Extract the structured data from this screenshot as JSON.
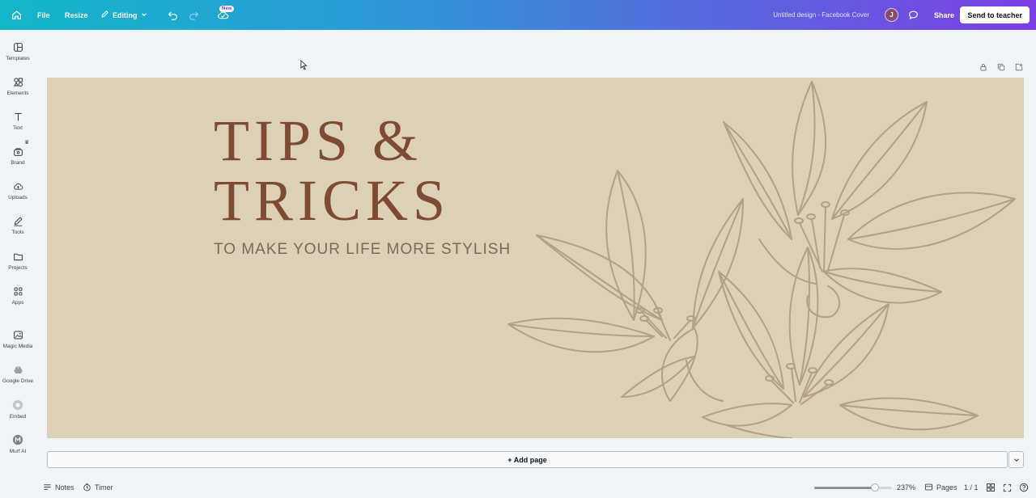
{
  "topbar": {
    "file": "File",
    "resize": "Resize",
    "editing": "Editing",
    "new_badge": "New",
    "doc_title": "Untitled design - Facebook Cover",
    "avatar_initial": "J",
    "share": "Share",
    "send": "Send to teacher"
  },
  "sidebar": {
    "items": [
      {
        "label": "Templates",
        "icon": "templates-icon"
      },
      {
        "label": "Elements",
        "icon": "elements-icon"
      },
      {
        "label": "Text",
        "icon": "text-icon"
      },
      {
        "label": "Brand",
        "icon": "brand-icon"
      },
      {
        "label": "Uploads",
        "icon": "uploads-icon"
      },
      {
        "label": "Tools",
        "icon": "tools-icon"
      },
      {
        "label": "Projects",
        "icon": "projects-icon"
      },
      {
        "label": "Apps",
        "icon": "apps-icon"
      },
      {
        "label": "Magic Media",
        "icon": "magic-media-icon"
      },
      {
        "label": "Google Drive",
        "icon": "google-drive-icon"
      },
      {
        "label": "Embed",
        "icon": "embed-icon"
      },
      {
        "label": "Murf AI",
        "icon": "murf-ai-icon"
      }
    ]
  },
  "design": {
    "title_line1": "TIPS &",
    "title_line2": "TRICKS",
    "subtitle": "TO MAKE YOUR LIFE MORE STYLISH",
    "background": "#dcd0b7",
    "title_color": "#7d4a34",
    "line_color": "#b39f8a"
  },
  "add_page": "+ Add page",
  "bottombar": {
    "notes": "Notes",
    "timer": "Timer",
    "zoom_level": "237%",
    "zoom_fraction": 0.78,
    "pages": "Pages",
    "page_count": "1 / 1"
  }
}
